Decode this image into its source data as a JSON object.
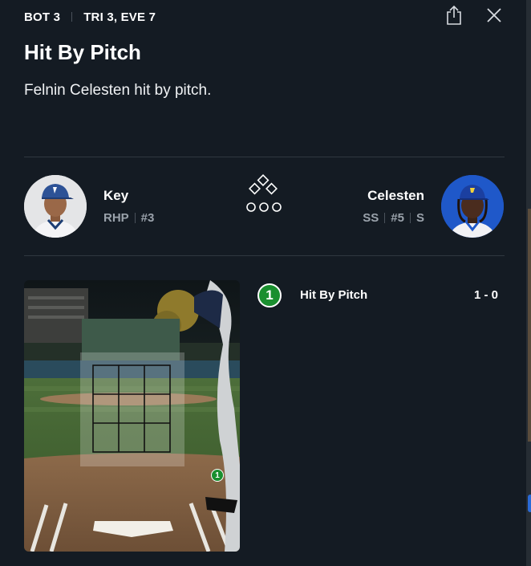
{
  "header": {
    "inning": "BOT 3",
    "matchup": "TRI 3, EVE 7"
  },
  "play": {
    "title": "Hit By Pitch",
    "description": "Felnin Celesten hit by pitch."
  },
  "pitcher": {
    "name": "Key",
    "position": "RHP",
    "number": "#3"
  },
  "batter": {
    "name": "Celesten",
    "position": "SS",
    "number": "#5",
    "bats": "S"
  },
  "pitches": [
    {
      "number": "1",
      "result": "Hit By Pitch",
      "count": "1 - 0"
    }
  ],
  "colors": {
    "background": "#141b23",
    "ball_badge": "#1a8f2f",
    "muted_text": "#9aa2ab"
  },
  "icons": [
    "share-icon",
    "close-icon",
    "bases-diamond-icon"
  ]
}
